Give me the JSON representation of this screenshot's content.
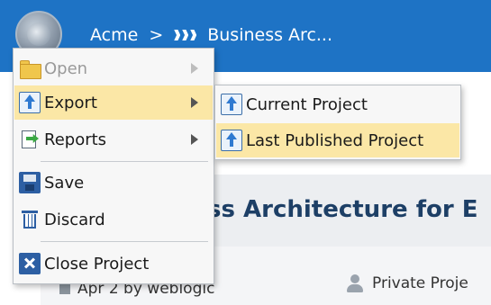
{
  "header": {
    "breadcrumb_root": "Acme",
    "breadcrumb_sep": ">",
    "breadcrumb_current": "Business Arc..."
  },
  "page": {
    "title": "ss Architecture for E",
    "date_meta": "Apr 2 by weblogic",
    "privacy": "Private Proje"
  },
  "menu": {
    "items": [
      {
        "label": "Open",
        "icon": "folder-icon",
        "disabled": true,
        "has_submenu": true
      },
      {
        "label": "Export",
        "icon": "export-icon",
        "active": true,
        "has_submenu": true
      },
      {
        "label": "Reports",
        "icon": "reports-icon",
        "has_submenu": true
      },
      {
        "label": "Save",
        "icon": "save-icon"
      },
      {
        "label": "Discard",
        "icon": "discard-icon"
      },
      {
        "label": "Close Project",
        "icon": "close-project-icon"
      }
    ]
  },
  "submenu": {
    "items": [
      {
        "label": "Current Project",
        "icon": "export-icon"
      },
      {
        "label": "Last Published Project",
        "icon": "export-icon",
        "active": true
      }
    ]
  },
  "colors": {
    "header_bg": "#1e73c5",
    "menu_highlight": "#fbe7a6",
    "title_color": "#1d3f66"
  }
}
